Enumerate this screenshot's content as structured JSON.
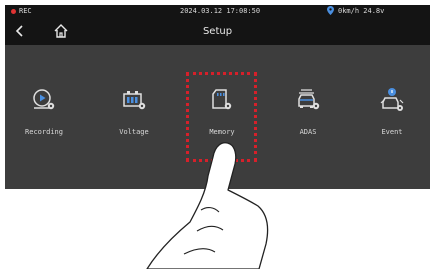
{
  "status": {
    "rec_label": "REC",
    "datetime": "2024.03.12 17:08:50",
    "gps_text": "0km/h 24.8v"
  },
  "header": {
    "title": "Setup"
  },
  "menu": {
    "items": [
      {
        "label": "Recording",
        "icon": "recording-icon"
      },
      {
        "label": "Voltage",
        "icon": "voltage-icon"
      },
      {
        "label": "Memory",
        "icon": "memory-card-icon"
      },
      {
        "label": "ADAS",
        "icon": "adas-icon"
      },
      {
        "label": "Event",
        "icon": "event-icon"
      }
    ]
  },
  "colors": {
    "accent": "#d6202a",
    "screen_bg": "#3d3d3d",
    "bar_bg": "#141414",
    "icon_blue": "#4a8fe0"
  }
}
